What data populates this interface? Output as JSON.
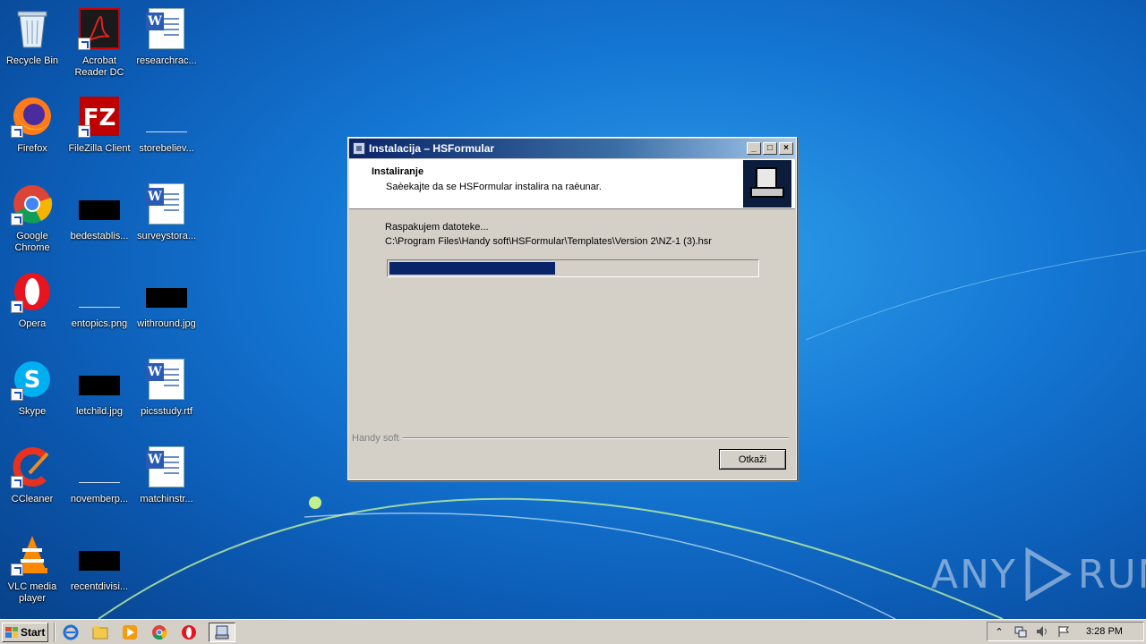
{
  "desktop": {
    "icons": [
      {
        "label": "Recycle Bin",
        "icon": "recycle-bin-icon"
      },
      {
        "label": "Acrobat Reader DC",
        "icon": "acrobat-icon"
      },
      {
        "label": "researchrac...",
        "icon": "word-doc-icon"
      },
      {
        "label": "Firefox",
        "icon": "firefox-icon"
      },
      {
        "label": "FileZilla Client",
        "icon": "filezilla-icon"
      },
      {
        "label": "storebeliev...",
        "icon": "blank-file-icon"
      },
      {
        "label": "Google Chrome",
        "icon": "chrome-icon"
      },
      {
        "label": "bedestablis...",
        "icon": "image-thumb-icon"
      },
      {
        "label": "surveystora...",
        "icon": "word-doc-icon"
      },
      {
        "label": "Opera",
        "icon": "opera-icon"
      },
      {
        "label": "entopics.png",
        "icon": "blank-file-icon"
      },
      {
        "label": "withround.jpg",
        "icon": "image-thumb-icon"
      },
      {
        "label": "Skype",
        "icon": "skype-icon"
      },
      {
        "label": "letchild.jpg",
        "icon": "image-thumb-icon"
      },
      {
        "label": "picsstudy.rtf",
        "icon": "word-doc-icon"
      },
      {
        "label": "CCleaner",
        "icon": "ccleaner-icon"
      },
      {
        "label": "novemberp...",
        "icon": "blank-file-icon"
      },
      {
        "label": "matchinstr...",
        "icon": "word-doc-icon"
      },
      {
        "label": "VLC media player",
        "icon": "vlc-icon"
      },
      {
        "label": "recentdivisi...",
        "icon": "image-thumb-icon"
      }
    ]
  },
  "dialog": {
    "title": "Instalacija – HSFormular",
    "minimize": "_",
    "maximize": "□",
    "close": "×",
    "header_title": "Instaliranje",
    "header_subtitle": "Saèekajte da se HSFormular instalira na raèunar.",
    "status": "Raspakujem datoteke...",
    "path": "C:\\Program Files\\Handy soft\\HSFormular\\Templates\\Version 2\\NZ-1 (3).hsr",
    "progress_fraction": 0.45,
    "brand": "Handy soft",
    "cancel_label": "Otkaži"
  },
  "watermark": {
    "left": "ANY",
    "right": "RUN"
  },
  "taskbar": {
    "start_label": "Start",
    "clock": "3:28 PM"
  }
}
